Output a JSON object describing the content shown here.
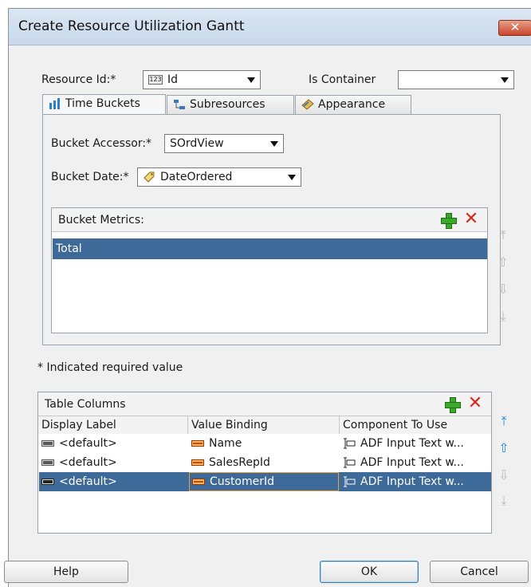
{
  "window": {
    "title": "Create Resource Utilization Gantt",
    "close_glyph": "✕"
  },
  "resource": {
    "label": "Resource Id:*",
    "value": "Id",
    "type_badge": "123"
  },
  "container": {
    "label": "Is Container",
    "value": ""
  },
  "tabs": [
    {
      "label": "Time Buckets",
      "icon": "sort-icon"
    },
    {
      "label": "Subresources",
      "icon": "hierarchy-icon"
    },
    {
      "label": "Appearance",
      "icon": "appearance-icon"
    }
  ],
  "time_buckets": {
    "accessor_label": "Bucket Accessor:*",
    "accessor_value": "SOrdView",
    "date_label": "Bucket Date:*",
    "date_value": "DateOrdered",
    "metrics_header": "Bucket Metrics:",
    "metrics": [
      "Total"
    ]
  },
  "required_note": "* Indicated required value",
  "table_columns": {
    "header": "Table Columns",
    "columns": [
      "Display Label",
      "Value Binding",
      "Component To Use"
    ],
    "rows": [
      {
        "display": "<default>",
        "binding": "Name",
        "component": "ADF Input Text w..."
      },
      {
        "display": "<default>",
        "binding": "SalesRepId",
        "component": "ADF Input Text w..."
      },
      {
        "display": "<default>",
        "binding": "CustomerId",
        "component": "ADF Input Text w..."
      }
    ]
  },
  "buttons": {
    "help": "Help",
    "ok": "OK",
    "cancel": "Cancel"
  },
  "colors": {
    "selection": "#3e6a9a",
    "add": "#3aa829",
    "delete": "#d9261c",
    "active_arrow": "#1f8ae8"
  }
}
